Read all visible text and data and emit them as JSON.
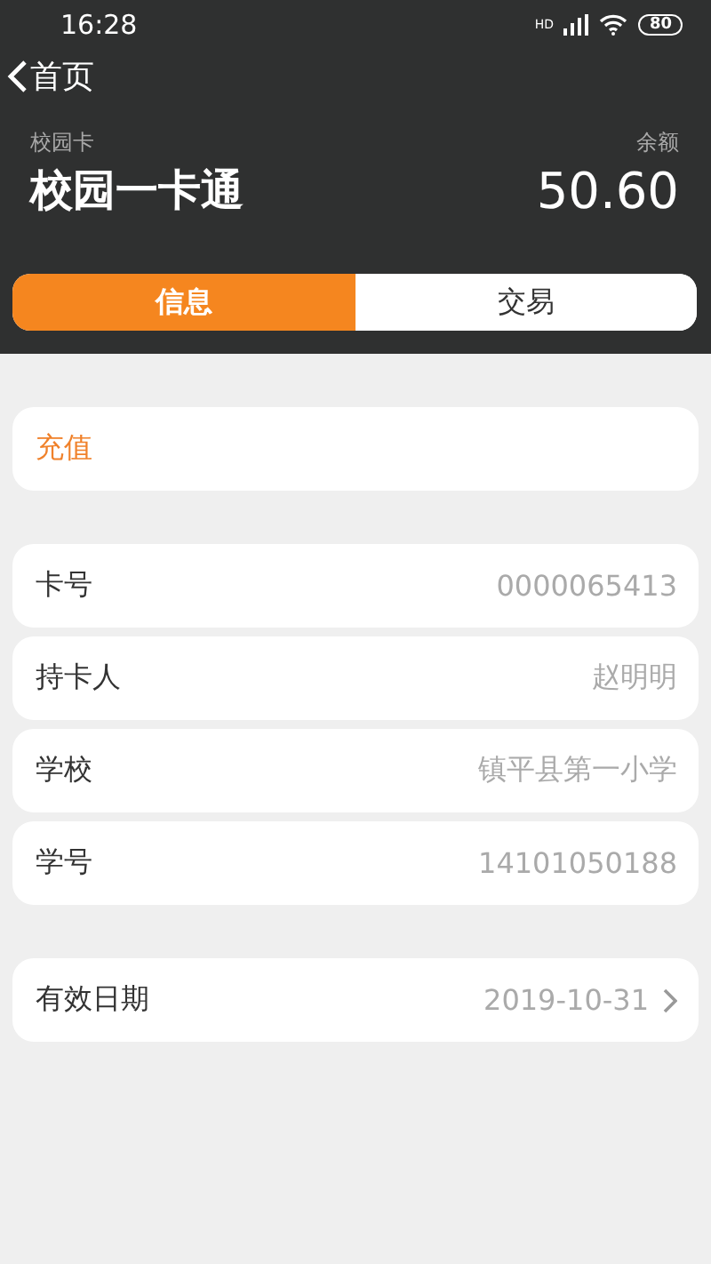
{
  "status_bar": {
    "time": "16:28",
    "network": "HD",
    "battery": "80"
  },
  "nav": {
    "back_label": "首页"
  },
  "card": {
    "label": "校园卡",
    "name": "校园一卡通",
    "balance_label": "余额",
    "balance": "50.60"
  },
  "tabs": [
    {
      "label": "信息",
      "selected": true
    },
    {
      "label": "交易",
      "selected": false
    }
  ],
  "sections": [
    {
      "rows": [
        {
          "kind": "action",
          "label": "充值"
        }
      ]
    },
    {
      "rows": [
        {
          "kind": "info",
          "label": "卡号",
          "value": "0000065413",
          "chevron": false
        },
        {
          "kind": "info",
          "label": "持卡人",
          "value": "赵明明",
          "chevron": false
        },
        {
          "kind": "info",
          "label": "学校",
          "value": "镇平县第一小学",
          "chevron": false
        },
        {
          "kind": "info",
          "label": "学号",
          "value": "14101050188",
          "chevron": false
        }
      ]
    },
    {
      "rows": [
        {
          "kind": "info",
          "label": "有效日期",
          "value": "2019-10-31",
          "chevron": true
        }
      ]
    }
  ]
}
